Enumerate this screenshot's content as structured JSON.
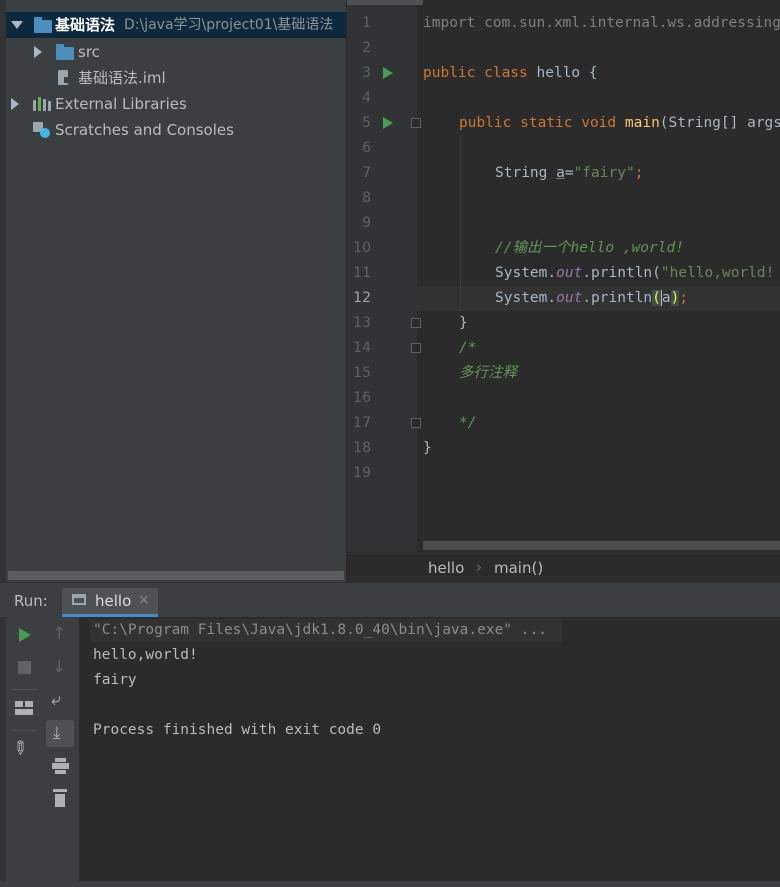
{
  "project": {
    "root_name": "基础语法",
    "root_path": "D:\\java学习\\project01\\基础语法",
    "items": [
      {
        "label": "src"
      },
      {
        "label": "基础语法.iml"
      },
      {
        "label": "External Libraries"
      },
      {
        "label": "Scratches and Consoles"
      }
    ]
  },
  "editor": {
    "line_numbers": [
      "1",
      "2",
      "3",
      "4",
      "5",
      "6",
      "7",
      "8",
      "9",
      "10",
      "11",
      "12",
      "13",
      "14",
      "15",
      "16",
      "17",
      "18",
      "19"
    ],
    "current_line": 12
  },
  "code": {
    "l1": "import com.sun.xml.internal.ws.addressing",
    "l3_kw": "public class ",
    "l3_name": "hello {",
    "l5_kw": "public static void ",
    "l5_fn": "main",
    "l5_rest": "(String[] args",
    "l7_type": "String ",
    "l7_var": "a",
    "l7_eq": "=",
    "l7_str": "\"fairy\"",
    "l7_semi": ";",
    "l10_comment": "//输出一个hello ,world!",
    "l11_pre": "System.",
    "l11_out": "out",
    "l11_mid": ".println(",
    "l11_str": "\"hello,world!",
    "l12_pre": "System.",
    "l12_out": "out",
    "l12_mid": ".println",
    "l12_open": "(",
    "l12_arg": "a",
    "l12_close": ")",
    "l12_semi": ";",
    "l13": "}",
    "l14": "/*",
    "l15": "多行注释",
    "l17": "*/",
    "l18": "}"
  },
  "breadcrumb": {
    "class_name": "hello",
    "separator": "›",
    "method": "main()"
  },
  "run": {
    "label": "Run:",
    "tab": "hello",
    "close": "×"
  },
  "console": {
    "lines": [
      "\"C:\\Program Files\\Java\\jdk1.8.0_40\\bin\\java.exe\" ...",
      "hello,world!",
      "fairy",
      "",
      "Process finished with exit code 0"
    ]
  },
  "colors": {
    "background": "#2b2b2b",
    "panel": "#3c3f41",
    "keyword": "#cc7832",
    "string": "#6a8759",
    "run_green": "#499c54"
  }
}
